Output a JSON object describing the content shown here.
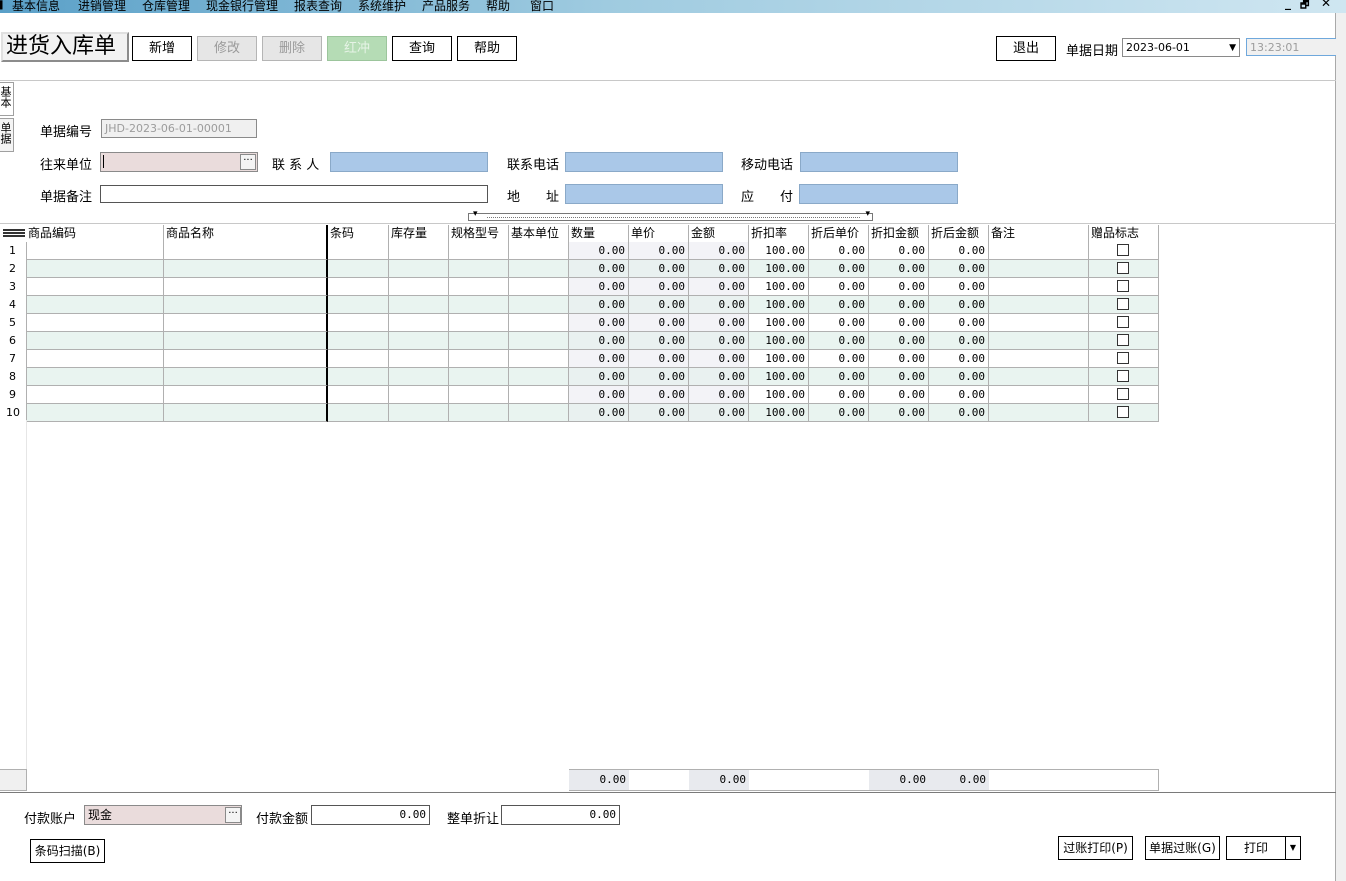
{
  "menu": {
    "items": [
      "基本信息",
      "进销管理",
      "仓库管理",
      "现金银行管理",
      "报表查询",
      "系统维护",
      "产品服务",
      "帮助",
      "窗口"
    ],
    "window_controls": {
      "minimize": "_",
      "restore": "🗗",
      "close": "✕"
    }
  },
  "toolbar": {
    "form_title": "进货入库单",
    "new_label": "新增",
    "edit_label": "修改",
    "delete_label": "删除",
    "red_flush_label": "红冲",
    "query_label": "查询",
    "help_label": "帮助",
    "exit_label": "退出",
    "date_label": "单据日期",
    "date_value": "2023-06-01",
    "time_value": "13:23:01"
  },
  "side_tabs": [
    "基本",
    "单据"
  ],
  "form": {
    "doc_no_label": "单据编号",
    "doc_no_value": "JHD-2023-06-01-00001",
    "partner_label": "往来单位",
    "partner_value": "",
    "contact_label": "联 系 人",
    "contact_value": "",
    "phone_label": "联系电话",
    "phone_value": "",
    "mobile_label": "移动电话",
    "mobile_value": "",
    "remark_label": "单据备注",
    "remark_value": "",
    "address_label": "地　　址",
    "address_value": "",
    "payable_label": "应　　付",
    "payable_value": ""
  },
  "grid": {
    "columns": [
      "商品编码",
      "商品名称",
      "条码",
      "库存量",
      "规格型号",
      "基本单位",
      "数量",
      "单价",
      "金额",
      "折扣率",
      "折后单价",
      "折扣金额",
      "折后金额",
      "备注",
      "赠品标志"
    ],
    "rows": [
      {
        "no": "1",
        "qty": "0.00",
        "price": "0.00",
        "amount": "0.00",
        "discount": "100.00",
        "disc_price": "0.00",
        "disc_amount": "0.00",
        "after_amount": "0.00",
        "gift": false
      },
      {
        "no": "2",
        "qty": "0.00",
        "price": "0.00",
        "amount": "0.00",
        "discount": "100.00",
        "disc_price": "0.00",
        "disc_amount": "0.00",
        "after_amount": "0.00",
        "gift": false
      },
      {
        "no": "3",
        "qty": "0.00",
        "price": "0.00",
        "amount": "0.00",
        "discount": "100.00",
        "disc_price": "0.00",
        "disc_amount": "0.00",
        "after_amount": "0.00",
        "gift": false
      },
      {
        "no": "4",
        "qty": "0.00",
        "price": "0.00",
        "amount": "0.00",
        "discount": "100.00",
        "disc_price": "0.00",
        "disc_amount": "0.00",
        "after_amount": "0.00",
        "gift": false
      },
      {
        "no": "5",
        "qty": "0.00",
        "price": "0.00",
        "amount": "0.00",
        "discount": "100.00",
        "disc_price": "0.00",
        "disc_amount": "0.00",
        "after_amount": "0.00",
        "gift": false
      },
      {
        "no": "6",
        "qty": "0.00",
        "price": "0.00",
        "amount": "0.00",
        "discount": "100.00",
        "disc_price": "0.00",
        "disc_amount": "0.00",
        "after_amount": "0.00",
        "gift": false
      },
      {
        "no": "7",
        "qty": "0.00",
        "price": "0.00",
        "amount": "0.00",
        "discount": "100.00",
        "disc_price": "0.00",
        "disc_amount": "0.00",
        "after_amount": "0.00",
        "gift": false
      },
      {
        "no": "8",
        "qty": "0.00",
        "price": "0.00",
        "amount": "0.00",
        "discount": "100.00",
        "disc_price": "0.00",
        "disc_amount": "0.00",
        "after_amount": "0.00",
        "gift": false
      },
      {
        "no": "9",
        "qty": "0.00",
        "price": "0.00",
        "amount": "0.00",
        "discount": "100.00",
        "disc_price": "0.00",
        "disc_amount": "0.00",
        "after_amount": "0.00",
        "gift": false
      },
      {
        "no": "10",
        "qty": "0.00",
        "price": "0.00",
        "amount": "0.00",
        "discount": "100.00",
        "disc_price": "0.00",
        "disc_amount": "0.00",
        "after_amount": "0.00",
        "gift": false
      }
    ],
    "totals": {
      "qty": "0.00",
      "amount": "0.00",
      "disc_amount": "0.00",
      "after_amount": "0.00"
    }
  },
  "bottom": {
    "account_label": "付款账户",
    "account_value": "现金",
    "pay_amount_label": "付款金额",
    "pay_amount_value": "0.00",
    "whole_discount_label": "整单折让",
    "whole_discount_value": "0.00",
    "barcode_button": "条码扫描(B)",
    "post_print_button": "过账打印(P)",
    "post_button": "单据过账(G)",
    "print_button": "打印"
  },
  "colors": {
    "menubar_start": "#5aa0c8",
    "blue_field": "#aac8e8",
    "pink_field": "#eadcdc",
    "alt_row": "#e9f4f0",
    "red_flush_bg": "#b5dcb5"
  }
}
